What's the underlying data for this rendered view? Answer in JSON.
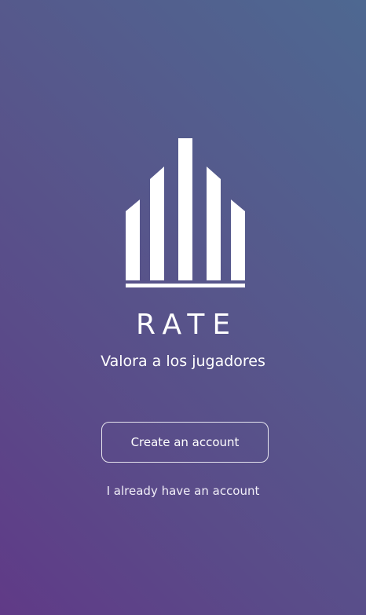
{
  "app": {
    "name": "RATE",
    "tagline": "Valora a los jugadores",
    "logo_icon": "bar-chart-logo-icon"
  },
  "actions": {
    "create_account_label": "Create an account",
    "login_label": "I already have an account"
  },
  "colors": {
    "gradient_top_right": "#4e6891",
    "gradient_bottom_left": "#603a87",
    "text": "#ffffff"
  }
}
